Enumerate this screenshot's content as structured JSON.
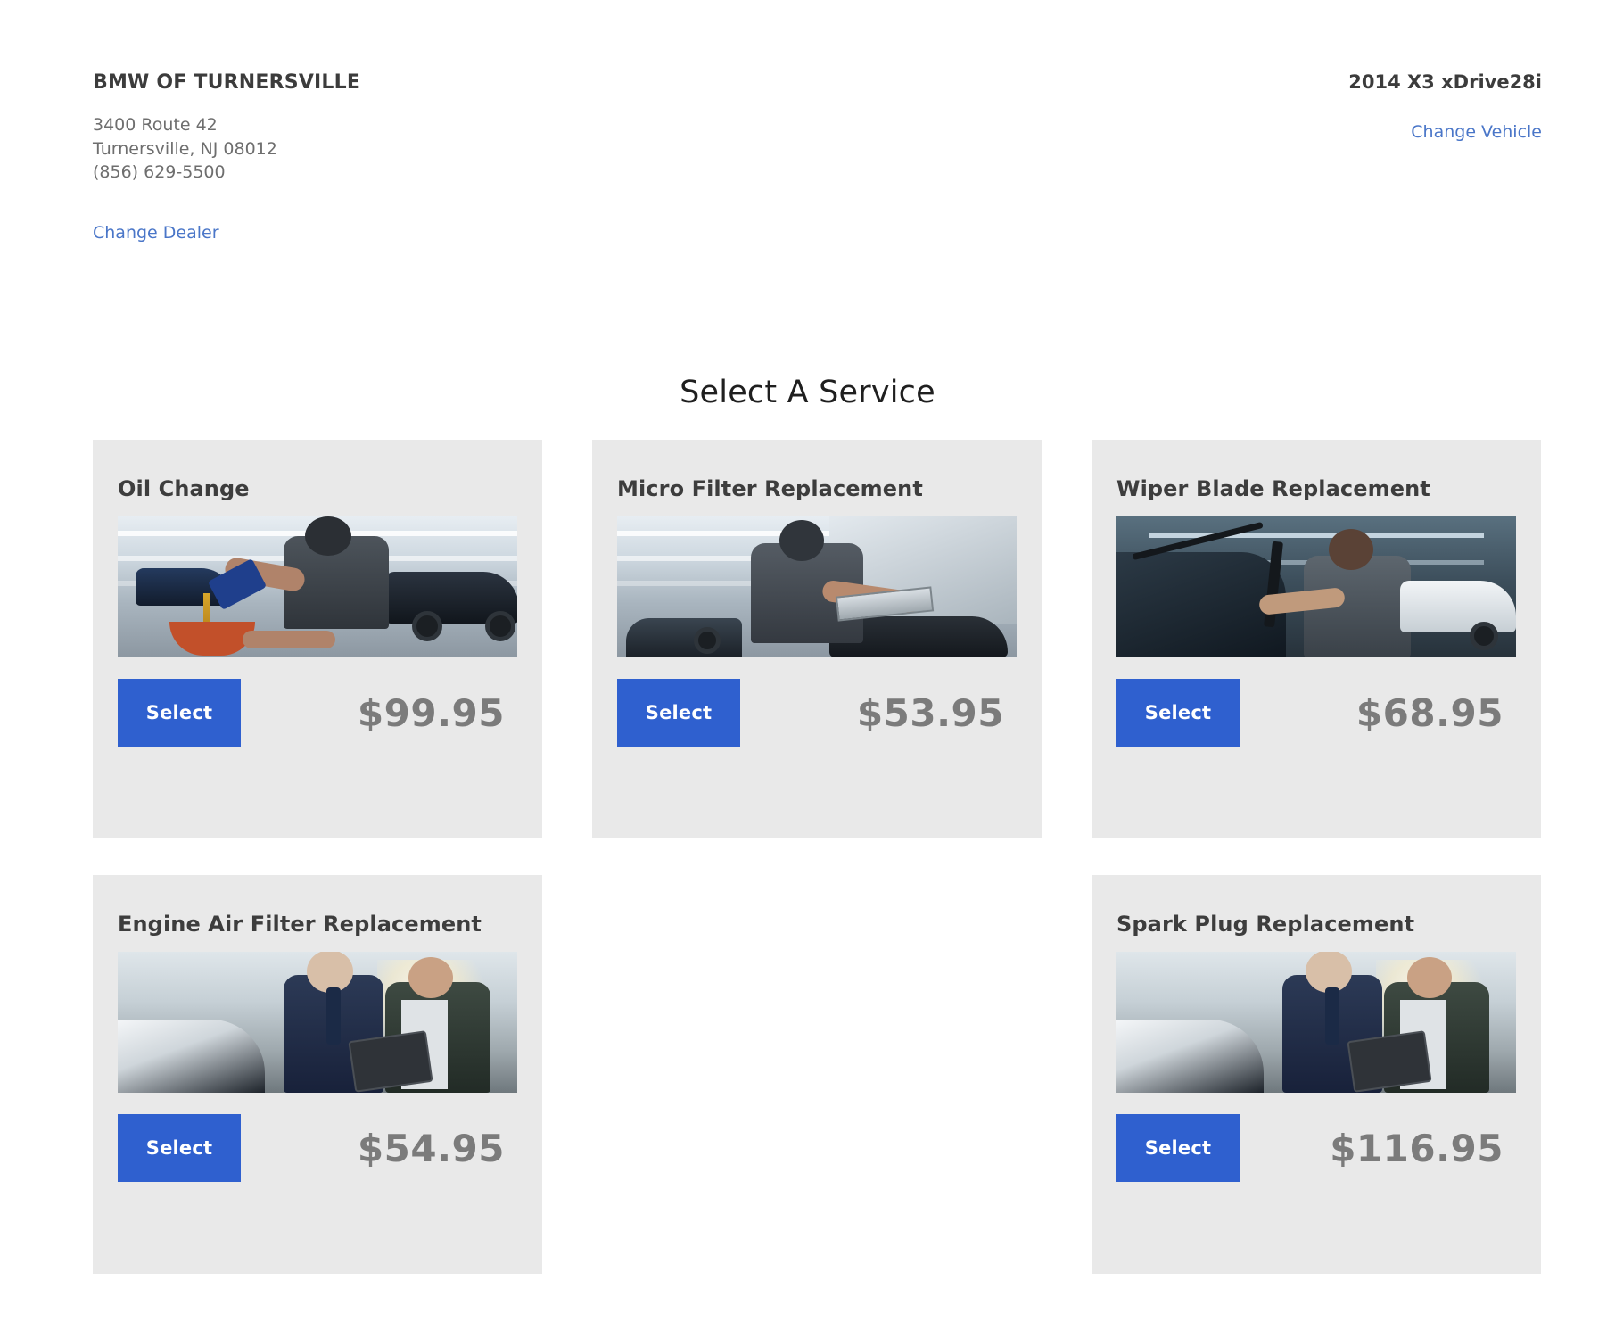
{
  "header": {
    "dealer": {
      "name": "BMW OF TURNERSVILLE",
      "address_line1": "3400 Route 42",
      "address_line2": "Turnersville, NJ 08012",
      "phone": "(856) 629-5500",
      "change_dealer_label": "Change Dealer"
    },
    "vehicle": {
      "name": "2014 X3 xDrive28i",
      "change_vehicle_label": "Change Vehicle"
    }
  },
  "main": {
    "section_title": "Select A Service",
    "select_button_label": "Select",
    "services": [
      {
        "title": "Oil Change",
        "price": "$99.95",
        "image_name": "oil-change-photo",
        "button_label": "Select"
      },
      {
        "title": "Micro Filter Replacement",
        "price": "$53.95",
        "image_name": "micro-filter-replacement-photo",
        "button_label": "Select"
      },
      {
        "title": "Wiper Blade Replacement",
        "price": "$68.95",
        "image_name": "wiper-blade-replacement-photo",
        "button_label": "Select"
      },
      {
        "title": "Engine Air Filter Replacement",
        "price": "$54.95",
        "image_name": "engine-air-filter-replacement-photo",
        "button_label": "Select"
      },
      {
        "title": "Spark Plug Replacement",
        "price": "$116.95",
        "image_name": "spark-plug-replacement-photo",
        "button_label": "Select"
      }
    ]
  },
  "colors": {
    "accent_blue": "#2f60cf",
    "link_blue": "#4a76c8",
    "card_background": "#e9e9e9",
    "price_gray": "#7b7b7b",
    "heading_dark": "#3c3c3c",
    "page_background": "#ffffff"
  }
}
